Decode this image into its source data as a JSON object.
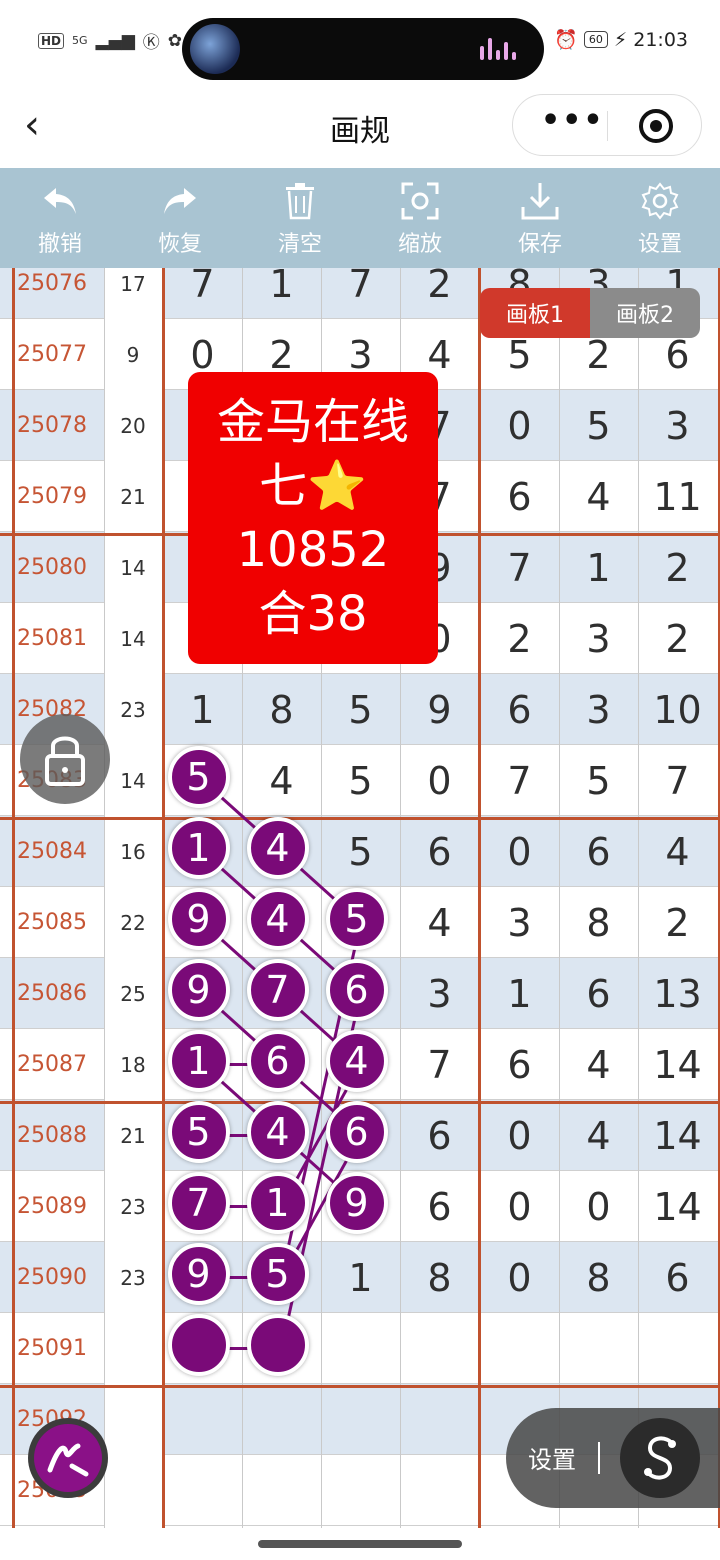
{
  "status_bar": {
    "left": {
      "hd": "HD",
      "net": "5G",
      "sig": "ıl"
    },
    "battery": "60",
    "time": "21:03"
  },
  "nav": {
    "back_icon": "chevron-left-icon",
    "title": "画规",
    "more_icon": "more-dots-icon",
    "close_icon": "target-icon"
  },
  "toolbar": [
    {
      "label": "撤销",
      "icon": "undo-icon"
    },
    {
      "label": "恢复",
      "icon": "redo-icon"
    },
    {
      "label": "清空",
      "icon": "trash-icon"
    },
    {
      "label": "缩放",
      "icon": "scan-icon"
    },
    {
      "label": "保存",
      "icon": "download-icon"
    },
    {
      "label": "设置",
      "icon": "gear-icon"
    }
  ],
  "board_tabs": [
    "画板1",
    "画板2"
  ],
  "promo": {
    "line1": "金马在线",
    "line2": "七⭐",
    "line3": "10852",
    "line4": "合38"
  },
  "rows": [
    {
      "issue": "25076",
      "sum": "17",
      "nums": [
        "7",
        "1",
        "7",
        "2",
        "8",
        "3",
        "1"
      ]
    },
    {
      "issue": "25077",
      "sum": "9",
      "nums": [
        "0",
        "2",
        "3",
        "4",
        "5",
        "2",
        "6"
      ]
    },
    {
      "issue": "25078",
      "sum": "20",
      "nums": [
        "",
        "",
        "",
        "7",
        "0",
        "5",
        "3"
      ]
    },
    {
      "issue": "25079",
      "sum": "21",
      "nums": [
        "",
        "",
        "",
        "7",
        "6",
        "4",
        "11"
      ]
    },
    {
      "issue": "25080",
      "sum": "14",
      "nums": [
        "",
        "",
        "",
        "9",
        "7",
        "1",
        "2"
      ]
    },
    {
      "issue": "25081",
      "sum": "14",
      "nums": [
        "",
        "",
        "",
        "0",
        "2",
        "3",
        "2"
      ]
    },
    {
      "issue": "25082",
      "sum": "23",
      "nums": [
        "1",
        "8",
        "5",
        "9",
        "6",
        "3",
        "10"
      ]
    },
    {
      "issue": "25083",
      "sum": "14",
      "nums": [
        "",
        "4",
        "5",
        "0",
        "7",
        "5",
        "7"
      ]
    },
    {
      "issue": "25084",
      "sum": "16",
      "nums": [
        "",
        "",
        "5",
        "6",
        "0",
        "6",
        "4"
      ]
    },
    {
      "issue": "25085",
      "sum": "22",
      "nums": [
        "",
        "",
        "",
        "4",
        "3",
        "8",
        "2"
      ]
    },
    {
      "issue": "25086",
      "sum": "25",
      "nums": [
        "",
        "",
        "",
        "3",
        "1",
        "6",
        "13"
      ]
    },
    {
      "issue": "25087",
      "sum": "18",
      "nums": [
        "",
        "",
        "",
        "7",
        "6",
        "4",
        "14"
      ]
    },
    {
      "issue": "25088",
      "sum": "21",
      "nums": [
        "",
        "",
        "",
        "6",
        "0",
        "4",
        "14"
      ]
    },
    {
      "issue": "25089",
      "sum": "23",
      "nums": [
        "",
        "",
        "",
        "6",
        "0",
        "0",
        "14"
      ]
    },
    {
      "issue": "25090",
      "sum": "23",
      "nums": [
        "",
        "",
        "1",
        "8",
        "0",
        "8",
        "6"
      ]
    },
    {
      "issue": "25091",
      "sum": "",
      "nums": [
        "",
        "",
        "",
        "",
        "",
        "",
        ""
      ]
    },
    {
      "issue": "25092",
      "sum": "",
      "nums": [
        "",
        "",
        "",
        "",
        "",
        "",
        ""
      ]
    },
    {
      "issue": "25093",
      "sum": "",
      "nums": [
        "",
        "",
        "",
        "",
        "",
        "",
        ""
      ]
    }
  ],
  "balls": [
    {
      "row": 7,
      "col": 0,
      "text": "5"
    },
    {
      "row": 8,
      "col": 0,
      "text": "1"
    },
    {
      "row": 8,
      "col": 1,
      "text": "4"
    },
    {
      "row": 9,
      "col": 0,
      "text": "9"
    },
    {
      "row": 9,
      "col": 1,
      "text": "4"
    },
    {
      "row": 9,
      "col": 2,
      "text": "5"
    },
    {
      "row": 10,
      "col": 0,
      "text": "9"
    },
    {
      "row": 10,
      "col": 1,
      "text": "7"
    },
    {
      "row": 10,
      "col": 2,
      "text": "6"
    },
    {
      "row": 11,
      "col": 0,
      "text": "1"
    },
    {
      "row": 11,
      "col": 1,
      "text": "6"
    },
    {
      "row": 11,
      "col": 2,
      "text": "4"
    },
    {
      "row": 12,
      "col": 0,
      "text": "5"
    },
    {
      "row": 12,
      "col": 1,
      "text": "4"
    },
    {
      "row": 12,
      "col": 2,
      "text": "6"
    },
    {
      "row": 13,
      "col": 0,
      "text": "7"
    },
    {
      "row": 13,
      "col": 1,
      "text": "1"
    },
    {
      "row": 13,
      "col": 2,
      "text": "9"
    },
    {
      "row": 14,
      "col": 0,
      "text": "9"
    },
    {
      "row": 14,
      "col": 1,
      "text": "5"
    },
    {
      "row": 15,
      "col": 0,
      "text": ""
    },
    {
      "row": 15,
      "col": 1,
      "text": ""
    }
  ],
  "setting_bar": {
    "label": "设置",
    "icon": "s-shape-icon"
  },
  "lock_icon": "lock-icon",
  "pen_icon": "pen-icon"
}
